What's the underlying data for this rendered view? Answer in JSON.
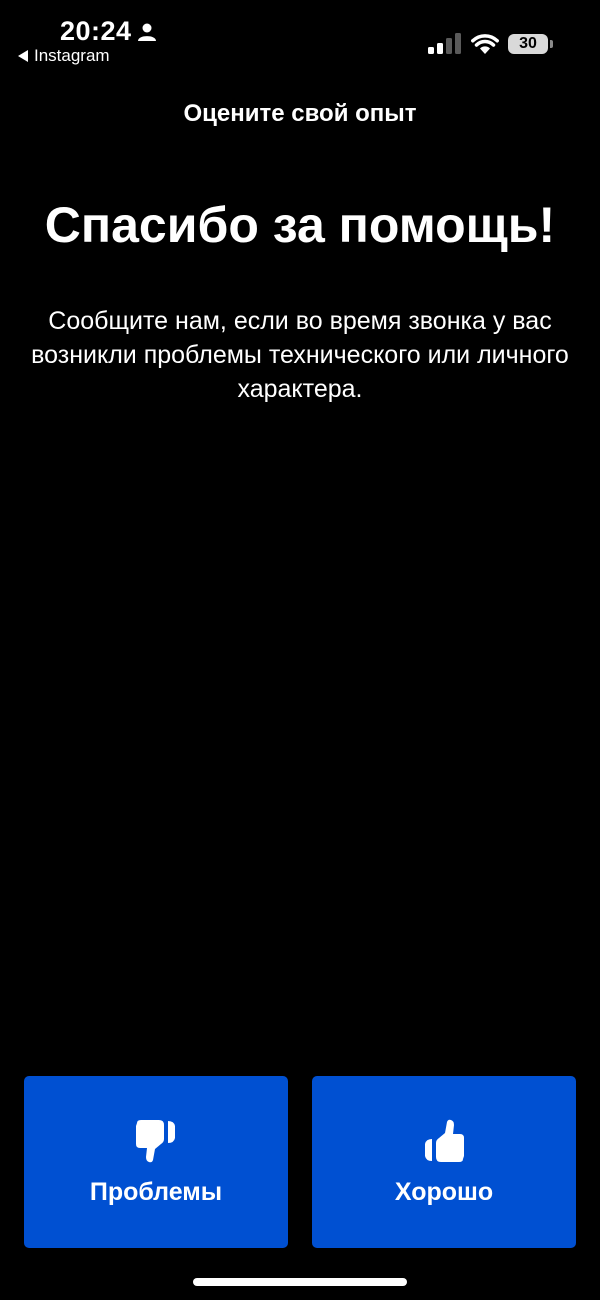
{
  "status_bar": {
    "time": "20:24",
    "back_app": "Instagram",
    "battery": "30"
  },
  "header": {
    "title": "Оцените свой опыт"
  },
  "main": {
    "title": "Спасибо за помощь!",
    "description": "Сообщите нам, если во время звонка у вас возникли проблемы технического или личного характера."
  },
  "actions": {
    "problems_label": "Проблемы",
    "good_label": "Хорошо"
  },
  "colors": {
    "background": "#000000",
    "button": "#0050d2",
    "text": "#ffffff"
  },
  "icons": {
    "problems": "thumbs-down-icon",
    "good": "thumbs-up-icon"
  }
}
